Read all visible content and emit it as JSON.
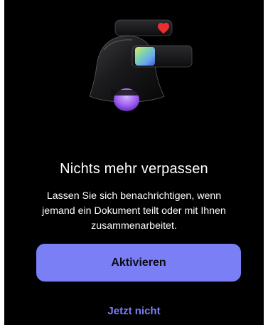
{
  "onboarding": {
    "title": "Nichts mehr verpassen",
    "description": "Lassen Sie sich benachrichtigen, wenn jemand ein Dokument teilt oder mit Ihnen zusammenarbeitet.",
    "primary_button": "Aktivieren",
    "secondary_link": "Jetzt nicht"
  },
  "colors": {
    "background": "#000000",
    "accent": "#7b7ff5",
    "heart": "#e8302f"
  },
  "icons": {
    "illustration": "notification-bell-illustration",
    "heart": "heart-icon"
  }
}
